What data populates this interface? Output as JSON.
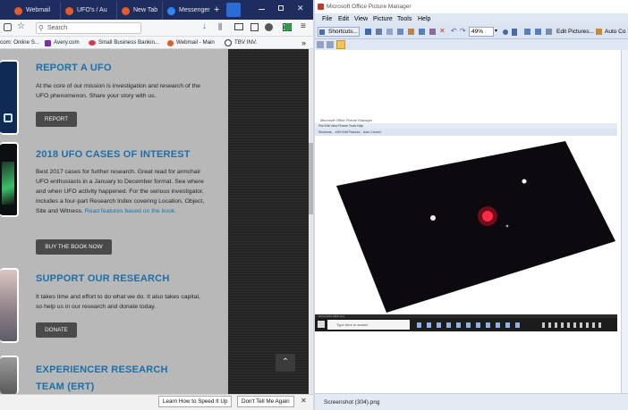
{
  "browser": {
    "tabs": [
      {
        "label": "Webmail",
        "color": "#e55b2c"
      },
      {
        "label": "UFO's / Au",
        "color": "#e55b2c"
      },
      {
        "label": "New Tab",
        "color": "#e55b2c"
      },
      {
        "label": "Messenger",
        "color": "#2d88ff"
      }
    ],
    "new_tab_symbol": "+",
    "search_placeholder": "Search",
    "bookmarks": [
      {
        "label": "com: Online S...",
        "icon": "window-icon"
      },
      {
        "label": "Avery.com",
        "icon": "avery-icon"
      },
      {
        "label": "Small Business Bankin...",
        "icon": "bank-icon"
      },
      {
        "label": "Webmail - Main",
        "icon": "webmail-icon"
      },
      {
        "label": "TBV INV.",
        "icon": "globe-icon"
      }
    ],
    "bookmarks_overflow": "»",
    "notification_bar": {
      "learn_label": "How to Speed It Up",
      "learn_prefix": "Learn",
      "dont_label": "Don't Tell Me Again",
      "close_symbol": "✕"
    },
    "scroll_top_symbol": "⌃"
  },
  "page": {
    "sections": [
      {
        "title": "REPORT A UFO",
        "body": "At the core of our mission is investigation and research of the UFO phenomenon. Share your story with us.",
        "link": "",
        "button": "REPORT"
      },
      {
        "title": "2018 UFO CASES OF INTEREST",
        "body": "Best 2017 cases for further research. Great read for armchair UFO enthusiasts in a January to December format. See where and when UFO activity happened. For the serious investigator, includes a four-part Research Index covering Location, Object, Site and Witness.",
        "link": "Read features based on the book.",
        "button": "BUY THE BOOK NOW"
      },
      {
        "title": "SUPPORT OUR RESEARCH",
        "body": "It takes time and effort to do what we do. It also takes capital, so help us in our research and donate today.",
        "link": "",
        "button": "DONATE"
      },
      {
        "title": "EXPERIENCER RESEARCH TEAM (ERT)",
        "body": "",
        "link": "",
        "button": ""
      }
    ]
  },
  "picture_manager": {
    "title": "Microsoft Office Picture Manager",
    "menu": [
      "File",
      "Edit",
      "View",
      "Picture",
      "Tools",
      "Help"
    ],
    "toolbar": {
      "shortcuts_label": "Shortcuts...",
      "zoom_value": "49%",
      "edit_pictures_label": "Edit Pictures...",
      "auto_correct_label": "Auto Co"
    },
    "status_filename": "Screenshot (304).png",
    "inner": {
      "title": "Microsoft Office Picture Manager",
      "menu": "File  Edit  View  Picture  Tools  Help",
      "toolbar": "Shortcuts...   49%   Edit Pictures...   Auto Correct",
      "status": "Screenshot (303).png",
      "search_placeholder": "Type here to search"
    }
  },
  "colors": {
    "tab_bar": "#1f2d5e",
    "heading_blue": "#1d6fa8",
    "content_gray": "#b8b8b8"
  }
}
